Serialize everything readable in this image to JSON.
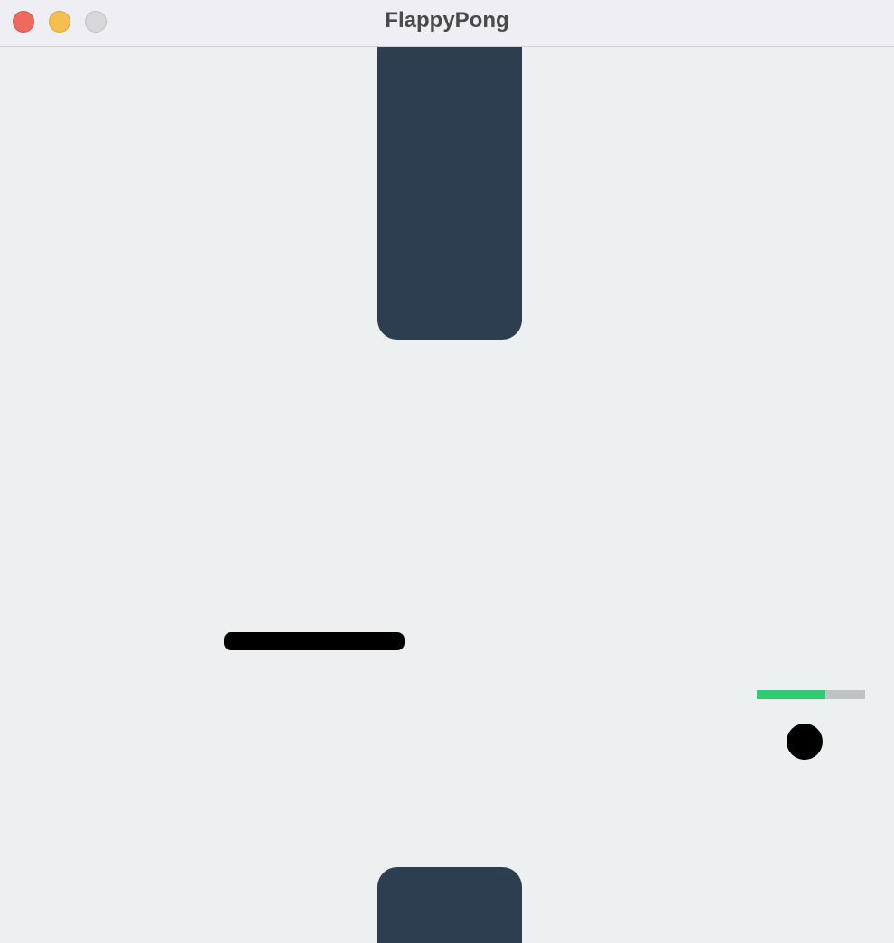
{
  "window": {
    "title": "FlappyPong",
    "controls": [
      "close",
      "minimize",
      "zoom"
    ]
  },
  "colors": {
    "background": "#ECF0F1",
    "pipe": "#2C3E50",
    "paddle": "#000000",
    "ball": "#000000",
    "energy_fill": "#2ECC71",
    "energy_track": "#BDC3C7",
    "close": "#EC6A5E",
    "minimize": "#F4BF4F",
    "zoom": "#D7D6DB"
  },
  "game": {
    "energy_level": 0.63
  }
}
